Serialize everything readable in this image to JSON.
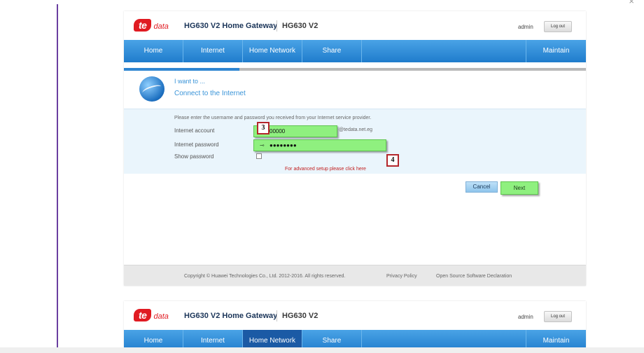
{
  "corner_close": "×",
  "step1": {
    "brand_badge": "te",
    "brand_suffix": "data",
    "title": "HG630 V2 Home Gateway",
    "model": "HG630 V2",
    "user": "admin",
    "logout_label": "Log out",
    "nav": [
      "Home",
      "Internet",
      "Home Network",
      "Share",
      "Maintain"
    ],
    "wizard_progress": 0.25,
    "want_line1": "I want to ...",
    "want_line2": "Connect to the Internet",
    "intro": "Please enter the username and password you received from your Internet service provider.",
    "account_label": "Internet account",
    "account_value": "00000",
    "account_domain": "@tedata.net.eg",
    "password_label": "Internet password",
    "password_value": "●●●●●●●●",
    "show_password_label": "Show password",
    "advanced_link": "For advanced setup please click here",
    "cancel_label": "Cancel",
    "next_label": "Next",
    "callout_password": "3",
    "callout_next": "4",
    "footer_copyright": "Copyright © Huawei Technologies Co., Ltd. 2012-2016. All rights reserved.",
    "footer_privacy": "Privacy Policy",
    "footer_oss": "Open Source Software Declaration"
  },
  "step2": {
    "brand_badge": "te",
    "brand_suffix": "data",
    "title": "HG630 V2 Home Gateway",
    "model": "HG630 V2",
    "user": "admin",
    "logout_label": "Log out",
    "nav": [
      "Home",
      "Internet",
      "Home Network",
      "Share",
      "Maintain"
    ],
    "active_tab": "Home Network"
  },
  "icons": {
    "account": "user-icon",
    "password": "key-icon",
    "globe": "globe-icon"
  },
  "colors": {
    "nav": "#2f86d2",
    "highlight": "#8ff07f",
    "callout_border": "#b3262b",
    "brand": "#e01b22"
  }
}
